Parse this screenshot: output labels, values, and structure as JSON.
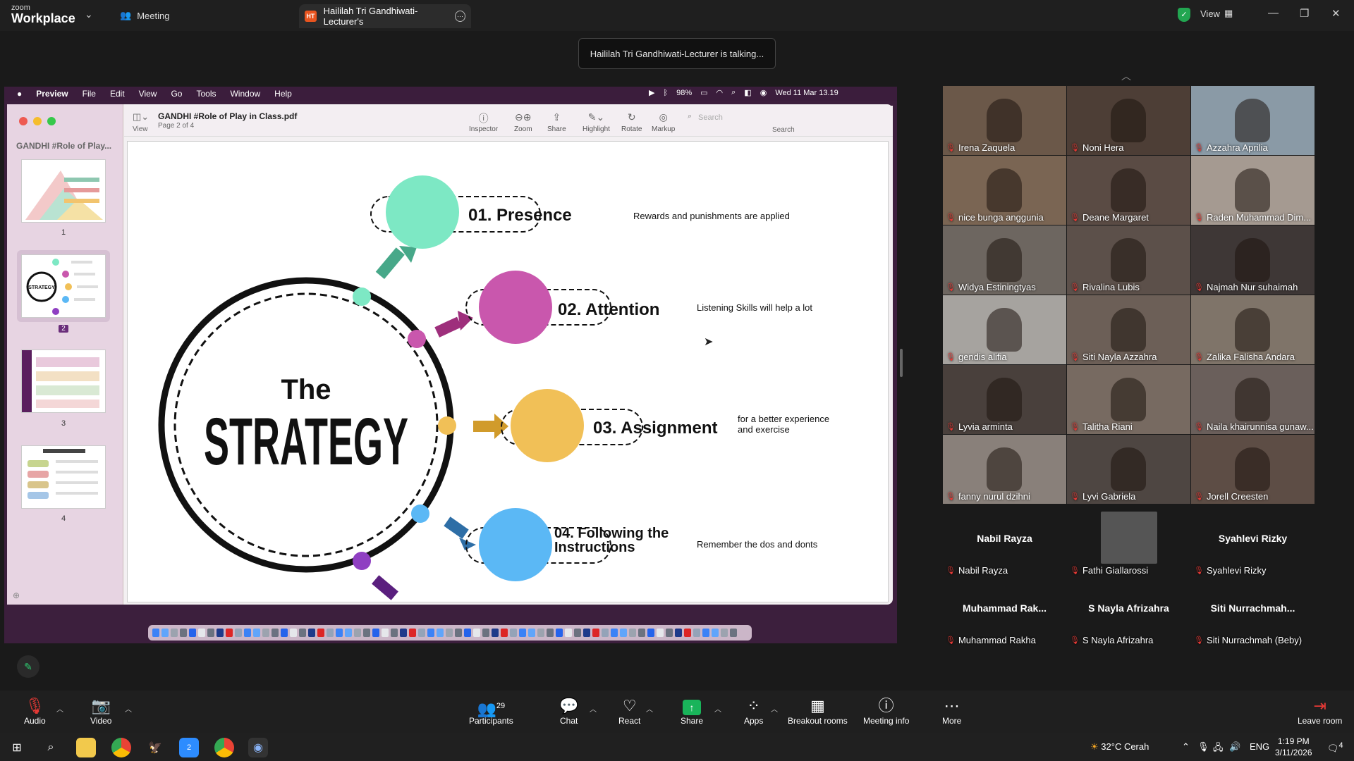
{
  "app": {
    "brand_small": "zoom",
    "brand_big": "Workplace",
    "meeting_tab": "Meeting",
    "share_tab": "Haililah Tri Gandhiwati-Lecturer's",
    "share_badge": "HT",
    "view_label": "View"
  },
  "banner": {
    "talking": "Haililah Tri Gandhiwati-Lecturer is talking..."
  },
  "mac": {
    "menu": [
      "Preview",
      "File",
      "Edit",
      "View",
      "Go",
      "Tools",
      "Window",
      "Help"
    ],
    "battery": "98%",
    "clock": "Wed 11 Mar 13.19"
  },
  "preview": {
    "doc_title": "GANDHI #Role of Play in Class.pdf",
    "doc_sub": "Page 2 of 4",
    "view_label": "View",
    "sidebar_title": "GANDHI #Role of Play...",
    "thumbs": [
      "1",
      "2",
      "3",
      "4"
    ],
    "toolbar": [
      "Inspector",
      "Zoom",
      "Share",
      "Highlight",
      "Rotate",
      "Markup"
    ],
    "search_placeholder": "Search",
    "search_label": "Search"
  },
  "slide": {
    "the": "The",
    "strategy": "STRATEGY",
    "items": [
      {
        "title": "01. Presence",
        "desc": "Rewards and punishments are applied",
        "color": "#7de8c4"
      },
      {
        "title": "02. Attention",
        "desc": "Listening Skills will help a lot",
        "color": "#c957ad"
      },
      {
        "title": "03. Assignment",
        "desc": "for a better experience and exercise",
        "color": "#f1c057"
      },
      {
        "title": "04. Following the Instructions",
        "desc": "Remember the dos and donts",
        "color": "#5bb8f5"
      }
    ],
    "accent_purple": "#8f3fc2"
  },
  "gallery": {
    "video_tiles": [
      "Irena Zaquela",
      "Noni Hera",
      "Azzahra Aprilia",
      "nice bunga anggunia",
      "Deane Margaret",
      "Raden Muhammad Dim...",
      "Widya Estiningtyas",
      "Rivalina Lubis",
      "Najmah Nur suhaimah",
      "gendis alifia",
      "Siti Nayla Azzahra",
      "Zalika Falisha Andara",
      "Lyvia arminta",
      "Talitha Riani",
      "Naila khairunnisa gunaw...",
      "fanny nurul dzihni",
      "Lyvi Gabriela",
      "Jorell Creesten"
    ],
    "name_tiles": [
      {
        "big": "Nabil Rayza",
        "small": "Nabil Rayza"
      },
      {
        "big": "",
        "small": "Fathi Giallarossi"
      },
      {
        "big": "Syahlevi Rizky",
        "small": "Syahlevi Rizky"
      },
      {
        "big": "Muhammad  Rak...",
        "small": "Muhammad Rakha"
      },
      {
        "big": "S Nayla Afrizahra",
        "small": "S Nayla Afrizahra"
      },
      {
        "big": "Siti  Nurrachmah...",
        "small": "Siti Nurrachmah (Beby)"
      }
    ]
  },
  "controls": {
    "audio": "Audio",
    "video": "Video",
    "participants": "Participants",
    "participants_count": "29",
    "chat": "Chat",
    "react": "React",
    "share": "Share",
    "apps": "Apps",
    "breakout": "Breakout rooms",
    "info": "Meeting info",
    "more": "More",
    "leave": "Leave room"
  },
  "taskbar": {
    "weather": "32°C  Cerah",
    "lang": "ENG",
    "time": "1:19 PM",
    "date": "3/11/2026",
    "notif": "4",
    "zoom_badge": "2"
  }
}
